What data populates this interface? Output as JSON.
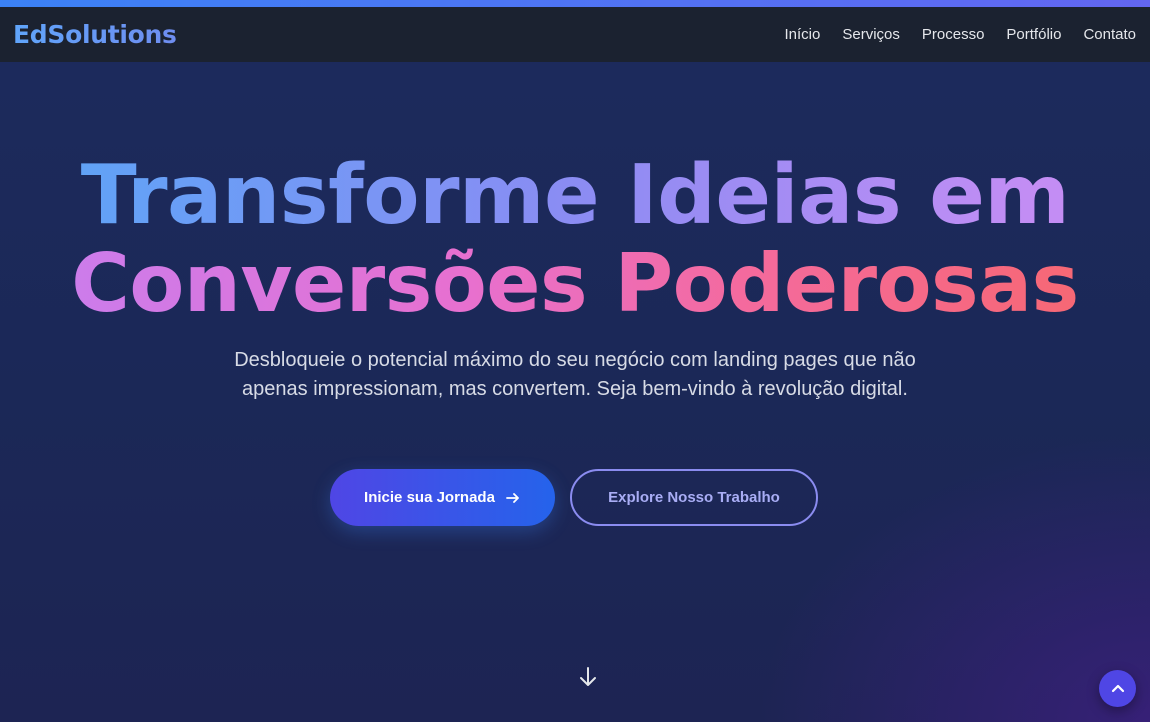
{
  "brand": {
    "name": "EdSolutions"
  },
  "nav": {
    "links": [
      "Início",
      "Serviços",
      "Processo",
      "Portfólio",
      "Contato"
    ]
  },
  "hero": {
    "headline_line1": "Transforme Ideias em",
    "headline_line2": "Conversões Poderosas",
    "subtitle": "Desbloqueie o potencial máximo do seu negócio com landing pages que não apenas impressionam, mas convertem. Seja bem-vindo à revolução digital.",
    "primary_cta": "Inicie sua Jornada",
    "secondary_cta": "Explore Nosso Trabalho"
  },
  "icons": {
    "cta_arrow": "arrow-right-icon",
    "scroll_down": "arrow-down-icon",
    "back_to_top": "chevron-up-icon"
  },
  "colors": {
    "accent_bar": "#3b82f6",
    "brand": "#5b9cf5",
    "primary_button": "#4f46e5",
    "secondary_border": "#8b8cf0",
    "hero_bg": "#1c2a5c"
  }
}
